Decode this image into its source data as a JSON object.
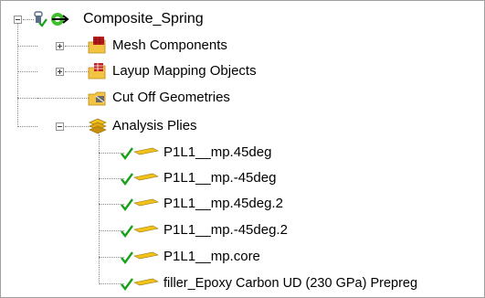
{
  "tree": {
    "root": {
      "label": "Composite_Spring",
      "expanded": true,
      "icon": "composite-spring-icon"
    },
    "children": [
      {
        "label": "Mesh Components",
        "expanded": false,
        "icon": "mesh-components-folder-icon"
      },
      {
        "label": "Layup Mapping Objects",
        "expanded": false,
        "icon": "layup-mapping-folder-icon"
      },
      {
        "label": "Cut Off Geometries",
        "icon": "cut-off-folder-icon"
      },
      {
        "label": "Analysis Plies",
        "expanded": true,
        "icon": "analysis-plies-stack-icon",
        "children": [
          {
            "label": "P1L1__mp.45deg",
            "status": "ok"
          },
          {
            "label": "P1L1__mp.-45deg",
            "status": "ok"
          },
          {
            "label": "P1L1__mp.45deg.2",
            "status": "ok"
          },
          {
            "label": "P1L1__mp.-45deg.2",
            "status": "ok"
          },
          {
            "label": "P1L1__mp.core",
            "status": "ok"
          },
          {
            "label": "filler_Epoxy Carbon UD (230 GPa) Prepreg",
            "status": "ok"
          }
        ]
      }
    ]
  },
  "colors": {
    "check": "#1aa01a",
    "ply": "#f2c21b",
    "folder": "#f3c442",
    "accent_red": "#c0201f"
  }
}
